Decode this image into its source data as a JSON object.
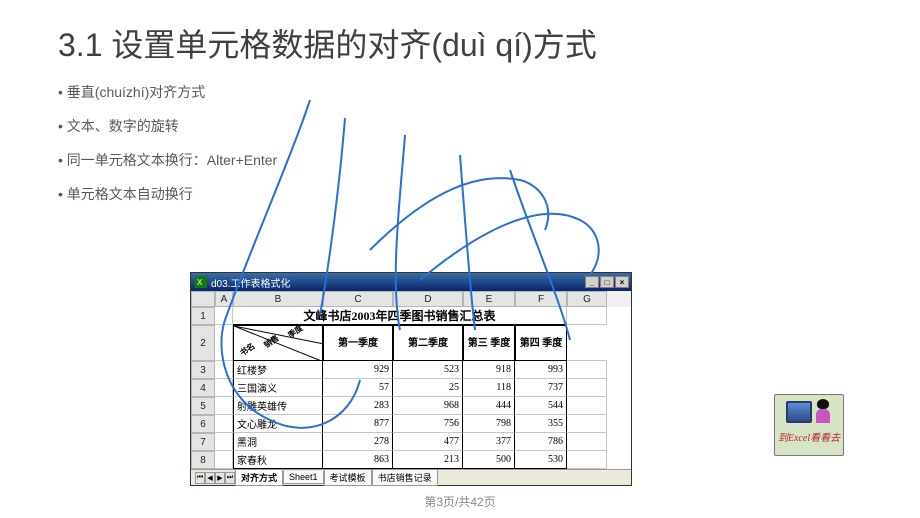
{
  "slide_title": "3.1  设置单元格数据的对齐(duì qí)方式",
  "bullets": [
    "垂直(chuízhí)对齐方式",
    "文本、数字的旋转",
    "同一单元格文本换行：Alter+Enter",
    "单元格文本自动换行"
  ],
  "excel": {
    "window_title": "d03.工作表格式化",
    "col_letters": [
      "A",
      "B",
      "C",
      "D",
      "E",
      "F",
      "G"
    ],
    "row_nums": [
      "1",
      "2",
      "3",
      "4",
      "5",
      "6",
      "7",
      "8"
    ],
    "merged_title": "文峰书店2003年四季图书销售汇总表",
    "diag_labels": [
      "季度",
      "销售",
      "书名"
    ],
    "headers": [
      "第一季度",
      "第二季度",
      "第三\n季度",
      "第四\n季度"
    ],
    "data": [
      {
        "name": "红楼梦",
        "v": [
          "929",
          "523",
          "918",
          "993"
        ]
      },
      {
        "name": "三国演义",
        "v": [
          "57",
          "25",
          "118",
          "737"
        ]
      },
      {
        "name": "射雕英雄传",
        "v": [
          "283",
          "968",
          "444",
          "544"
        ]
      },
      {
        "name": "文心雕龙",
        "v": [
          "877",
          "756",
          "798",
          "355"
        ]
      },
      {
        "name": "黑洞",
        "v": [
          "278",
          "477",
          "377",
          "786"
        ]
      },
      {
        "name": "家春秋",
        "v": [
          "863",
          "213",
          "500",
          "530"
        ]
      }
    ],
    "tabs": [
      "对齐方式",
      "Sheet1",
      "考试模板",
      "书店销售记录"
    ]
  },
  "sticker_label": "到Excel看看去",
  "page_num_text": "第3页/共42页"
}
